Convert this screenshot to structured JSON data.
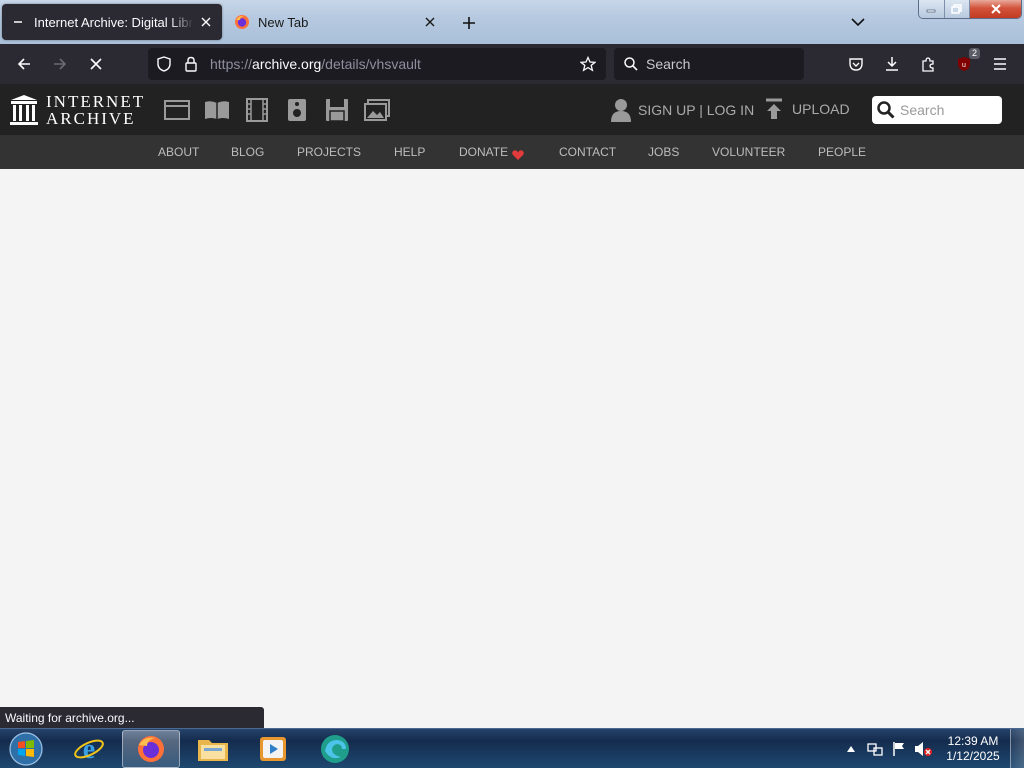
{
  "browser": {
    "tabs": [
      {
        "title": "Internet Archive: Digital Library",
        "active": true,
        "favicon": "ia-favicon-icon"
      },
      {
        "title": "New Tab",
        "active": false,
        "favicon": "firefox-icon"
      }
    ],
    "url": {
      "scheme": "https://",
      "domain": "archive.org",
      "path": "/details/vhsvault"
    },
    "search_placeholder": "Search",
    "extension_badge": "2",
    "status_text": "Waiting for archive.org..."
  },
  "ia": {
    "logo_line1": "INTERNET",
    "logo_line2": "ARCHIVE",
    "media_icons": [
      "web-icon",
      "texts-icon",
      "video-icon",
      "audio-icon",
      "software-icon",
      "images-icon"
    ],
    "account_label": "SIGN UP | LOG IN",
    "upload_label": "UPLOAD",
    "search_placeholder": "Search",
    "nav": [
      "ABOUT",
      "BLOG",
      "PROJECTS",
      "HELP",
      "DONATE",
      "CONTACT",
      "JOBS",
      "VOLUNTEER",
      "PEOPLE"
    ],
    "donate_heart_color": "#e23b3b"
  },
  "taskbar": {
    "apps": [
      "internet-explorer-icon",
      "firefox-icon",
      "file-explorer-icon",
      "media-player-icon",
      "edge-icon"
    ],
    "active_app": "firefox-icon",
    "time": "12:39 AM",
    "date": "1/12/2025"
  },
  "colors": {
    "browser_chrome": "#2b2a33",
    "ia_header": "#222222",
    "ia_nav": "#333333",
    "page_bg": "#f5f4f5"
  }
}
